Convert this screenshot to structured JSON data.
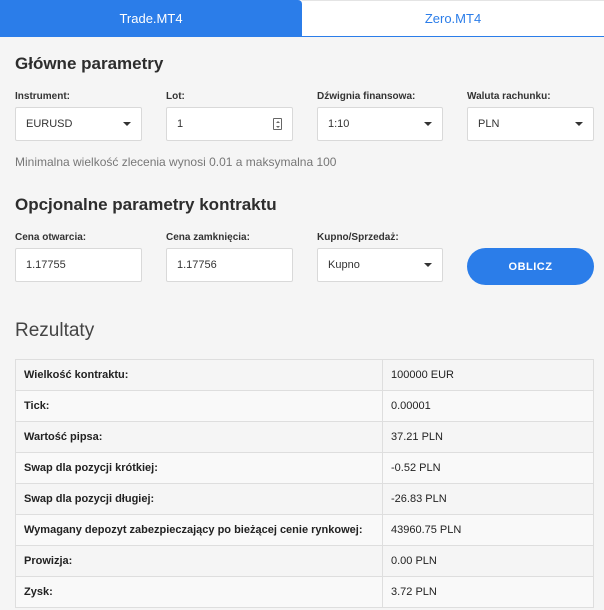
{
  "tabs": [
    {
      "label": "Trade.MT4",
      "active": true
    },
    {
      "label": "Zero.MT4",
      "active": false
    }
  ],
  "main_params": {
    "title": "Główne parametry",
    "instrument": {
      "label": "Instrument:",
      "value": "EURUSD"
    },
    "lot": {
      "label": "Lot:",
      "value": "1"
    },
    "leverage": {
      "label": "Dźwignia finansowa:",
      "value": "1:10"
    },
    "currency": {
      "label": "Waluta rachunku:",
      "value": "PLN"
    },
    "note": "Minimalna wielkość zlecenia wynosi 0.01 a maksymalna 100"
  },
  "optional_params": {
    "title": "Opcjonalne parametry kontraktu",
    "open_price": {
      "label": "Cena otwarcia:",
      "value": "1.17755"
    },
    "close_price": {
      "label": "Cena zamknięcia:",
      "value": "1.17756"
    },
    "side": {
      "label": "Kupno/Sprzedaż:",
      "value": "Kupno"
    },
    "calculate_label": "OBLICZ"
  },
  "results": {
    "title": "Rezultaty",
    "rows": [
      {
        "label": "Wielkość kontraktu:",
        "value": "100000 EUR"
      },
      {
        "label": "Tick:",
        "value": "0.00001"
      },
      {
        "label": "Wartość pipsa:",
        "value": "37.21 PLN"
      },
      {
        "label": "Swap dla pozycji krótkiej:",
        "value": "-0.52 PLN"
      },
      {
        "label": "Swap dla pozycji długiej:",
        "value": "-26.83 PLN"
      },
      {
        "label": "Wymagany depozyt zabezpieczający po bieżącej cenie rynkowej:",
        "value": "43960.75 PLN"
      },
      {
        "label": "Prowizja:",
        "value": "0.00 PLN"
      },
      {
        "label": "Zysk:",
        "value": "3.72 PLN"
      }
    ]
  },
  "colors": {
    "accent": "#2b7de9",
    "background": "#f5f5f5"
  }
}
